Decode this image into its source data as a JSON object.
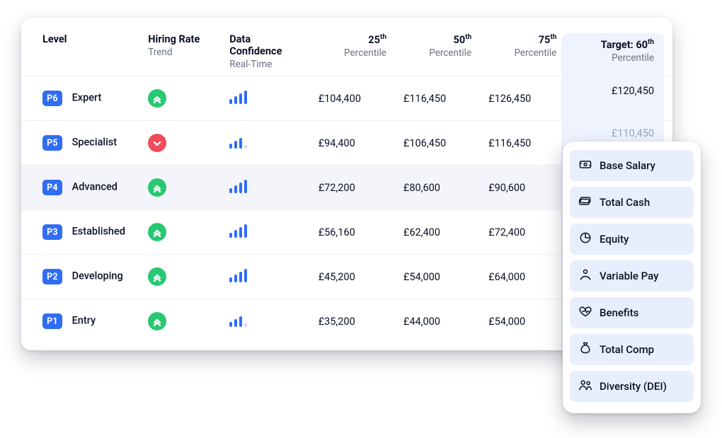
{
  "headers": {
    "level": "Level",
    "hiring_rate": "Hiring Rate",
    "hiring_rate_sub": "Trend",
    "confidence": "Data Confidence",
    "confidence_sub": "Real-Time",
    "p_label": "Percentile",
    "p25": "25",
    "p50": "50",
    "p75": "75",
    "target_prefix": "Target: ",
    "target_val": "60"
  },
  "rows": [
    {
      "badge": "P6",
      "label": "Expert",
      "trend": "up",
      "conf": "full",
      "p25": "£104,400",
      "p50": "£116,450",
      "p75": "£126,450",
      "target": "£120,450",
      "sel": false,
      "fade": false
    },
    {
      "badge": "P5",
      "label": "Specialist",
      "trend": "down",
      "conf": "med1",
      "p25": "£94,400",
      "p50": "£106,450",
      "p75": "£116,450",
      "target": "£110,450",
      "sel": false,
      "fade": true
    },
    {
      "badge": "P4",
      "label": "Advanced",
      "trend": "up",
      "conf": "full",
      "p25": "£72,200",
      "p50": "£80,600",
      "p75": "£90,600",
      "target": "",
      "sel": true,
      "fade": false
    },
    {
      "badge": "P3",
      "label": "Established",
      "trend": "up",
      "conf": "full",
      "p25": "£56,160",
      "p50": "£62,400",
      "p75": "£72,400",
      "target": "",
      "sel": false,
      "fade": false
    },
    {
      "badge": "P2",
      "label": "Developing",
      "trend": "up",
      "conf": "full",
      "p25": "£45,200",
      "p50": "£54,000",
      "p75": "£64,000",
      "target": "",
      "sel": false,
      "fade": false
    },
    {
      "badge": "P1",
      "label": "Entry",
      "trend": "up",
      "conf": "med2",
      "p25": "£35,200",
      "p50": "£44,000",
      "p75": "£54,000",
      "target": "",
      "sel": false,
      "fade": false
    }
  ],
  "panel": [
    "Base Salary",
    "Total Cash",
    "Equity",
    "Variable Pay",
    "Benefits",
    "Total Comp",
    "Diversity (DEI)"
  ]
}
